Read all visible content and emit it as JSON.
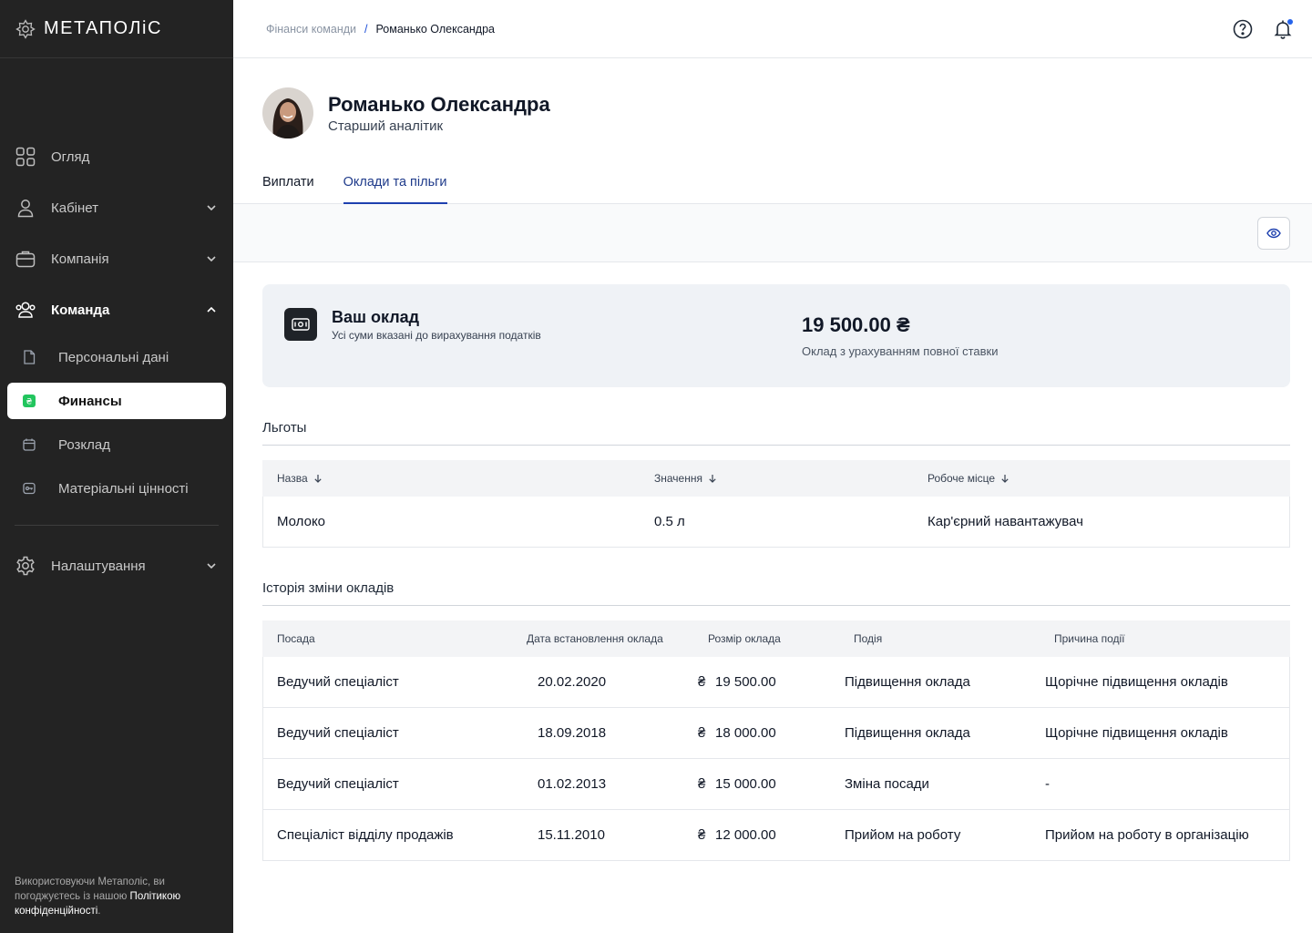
{
  "brand": {
    "name": "МЕТАПОЛіС"
  },
  "sidebar": {
    "items": [
      {
        "label": "Огляд",
        "icon": "grid-icon"
      },
      {
        "label": "Кабінет",
        "icon": "user-icon"
      },
      {
        "label": "Компанія",
        "icon": "briefcase-icon"
      },
      {
        "label": "Команда",
        "icon": "users-icon"
      },
      {
        "label": "Персональні дані",
        "icon": "document-icon"
      },
      {
        "label": "Финансы",
        "icon": "hryvnia-icon"
      },
      {
        "label": "Розклад",
        "icon": "calendar-icon"
      },
      {
        "label": "Матеріальні цінності",
        "icon": "asset-icon"
      },
      {
        "label": "Налаштування",
        "icon": "gear-icon"
      }
    ],
    "footer": {
      "text": "Використовуючи Метаполіс, ви погоджуєтесь із нашою ",
      "link": "Політикою конфіденційності",
      "end": "."
    }
  },
  "breadcrumb": {
    "parent": "Фінанси команди",
    "separator": "/",
    "current": "Романько Олександра"
  },
  "profile": {
    "name": "Романько Олександра",
    "role": "Старший аналітик"
  },
  "tabs": [
    {
      "label": "Виплати"
    },
    {
      "label": "Оклади та пільги"
    }
  ],
  "salary": {
    "title": "Ваш оклад",
    "subtitle": "Усі суми вказані до вирахування податків",
    "amount": "19 500.00 ₴",
    "note": "Оклад з урахуванням повної ставки"
  },
  "benefits": {
    "title": "Льготы",
    "columns": [
      "Назва",
      "Значення",
      "Робоче місце"
    ],
    "rows": [
      [
        "Молоко",
        "0.5 л",
        "Кар'єрний навантажувач"
      ]
    ]
  },
  "history": {
    "title": "Історія зміни окладів",
    "columns": [
      "Посада",
      "Дата встановлення оклада",
      "Розмір оклада",
      "Подія",
      "Причина події"
    ],
    "currency": "₴",
    "rows": [
      [
        "Ведучий спеціаліст",
        "20.02.2020",
        "19 500.00",
        "Підвищення оклада",
        "Щорічне підвищення окладів"
      ],
      [
        "Ведучий спеціаліст",
        "18.09.2018",
        "18 000.00",
        "Підвищення оклада",
        "Щорічне підвищення окладів"
      ],
      [
        "Ведучий спеціаліст",
        "01.02.2013",
        "15 000.00",
        "Зміна посади",
        "-"
      ],
      [
        "Спеціаліст відділу продажів",
        "15.11.2010",
        "12 000.00",
        "Прийом на роботу",
        "Прийом на роботу в організацію"
      ]
    ]
  },
  "colors": {
    "sidebar": "#232323",
    "accent": "#1e40af",
    "finance_badge": "#22c55e",
    "notification": "#2563eb"
  }
}
